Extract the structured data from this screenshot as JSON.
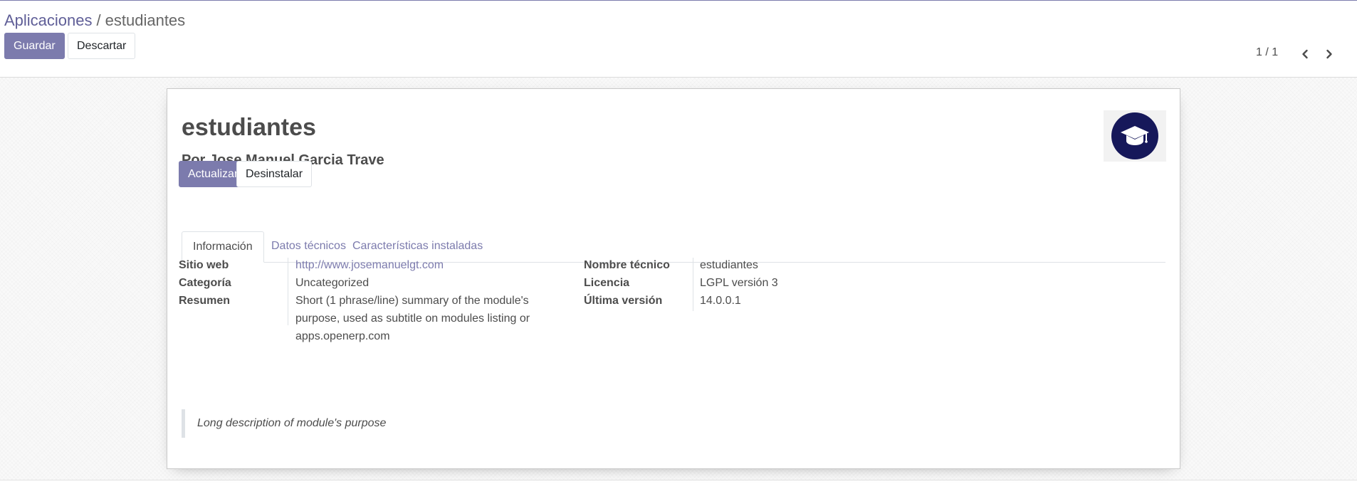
{
  "breadcrumb": {
    "parent": "Aplicaciones",
    "separator": "/",
    "current": "estudiantes"
  },
  "toolbar": {
    "save_label": "Guardar",
    "discard_label": "Descartar"
  },
  "pager": {
    "value": "1 / 1",
    "prev_icon": "chevron-left-icon",
    "next_icon": "chevron-right-icon"
  },
  "module": {
    "title": "estudiantes",
    "author": "Por Jose Manuel Garcia Trave",
    "icon": "graduation-cap-icon",
    "icon_bg_color": "#16185a",
    "buttons": {
      "update_label": "Actualizar",
      "uninstall_label": "Desinstalar"
    }
  },
  "tabs": [
    {
      "label": "Información",
      "active": true
    },
    {
      "label": "Datos técnicos",
      "active": false
    },
    {
      "label": "Características instaladas",
      "active": false
    }
  ],
  "info": {
    "left": [
      {
        "label": "Sitio web",
        "value": "http://www.josemanuelgt.com"
      },
      {
        "label": "Categoría",
        "value": "Uncategorized"
      },
      {
        "label": "Resumen",
        "value": "Short (1 phrase/line) summary of the module's purpose, used as subtitle on modules listing or apps.openerp.com"
      }
    ],
    "right": [
      {
        "label": "Nombre técnico",
        "value": "estudiantes"
      },
      {
        "label": "Licencia",
        "value": "LGPL versión 3"
      },
      {
        "label": "Última versión",
        "value": "14.0.0.1"
      }
    ]
  },
  "description": "Long description of module's purpose",
  "colors": {
    "primary": "#7c7bad",
    "breadcrumb_link": "#5f5e97",
    "text": "#4c4c4c"
  }
}
